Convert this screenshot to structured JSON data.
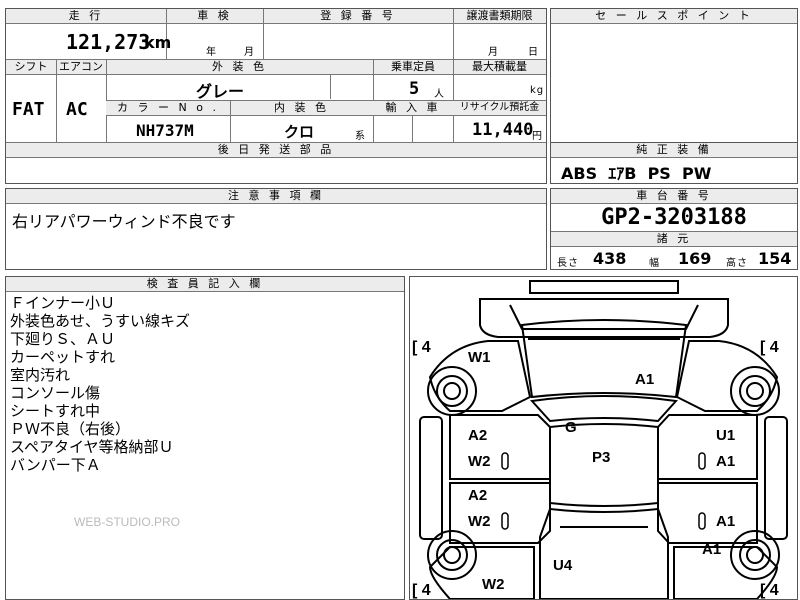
{
  "top_table": {
    "mileage_header": "走 行",
    "mileage_value": "121,273",
    "mileage_unit": "km",
    "inspection_header": "車 検",
    "inspection_year": "年",
    "inspection_month": "月",
    "registration_header": "登 録 番 号",
    "transfer_header": "譲渡書類期限",
    "transfer_month": "月",
    "transfer_day": "日",
    "shift_header": "シフト",
    "aircon_header": "エアコン",
    "color_header": "外 装 色",
    "seats_header": "乗車定員",
    "load_header": "最大積載量",
    "shift_value": "FAT",
    "aircon_value": "AC",
    "color_value": "グレー",
    "seats_value": "5",
    "seats_unit": "人",
    "load_unit": "kg",
    "color_no_header": "カ ラ ー N o .",
    "interior_header": "内 装 色",
    "import_header": "輸 入 車",
    "recycle_header": "リサイクル預託金",
    "color_no_value": "NH737M",
    "interior_value": "クロ",
    "interior_unit": "系",
    "recycle_value": "11,440",
    "recycle_unit": "円",
    "later_parts_header": "後 日 発 送 部 品"
  },
  "sales_point": {
    "header": "セ ー ル ス ポ イ ン ト"
  },
  "equipment": {
    "header": "純 正 装 備",
    "value": "ABS  ｴｱB  PS  PW"
  },
  "caution": {
    "header": "注 意 事 項 欄",
    "text": "右リアパワーウィンド不良です"
  },
  "chassis": {
    "header": "車 台 番 号",
    "value": "GP2-3203188",
    "spec_header": "諸 元",
    "length_label": "長さ",
    "length_value": "438",
    "width_label": "幅",
    "width_value": "169",
    "height_label": "高さ",
    "height_value": "154"
  },
  "inspector": {
    "header": "検 査 員 記 入 欄",
    "notes": [
      "Ｆインナー小Ｕ",
      "外装色あせ、うすい線キズ",
      "下廻りＳ、ＡＵ",
      "カーペットすれ",
      "室内汚れ",
      "コンソール傷",
      "シートすれ中",
      "ＰＷ不良（右後）",
      "スペアタイヤ等格納部Ｕ",
      "バンパー下Ａ"
    ],
    "watermark": "WEB-STUDIO.PRO"
  },
  "diagram": {
    "tire_fl": "4",
    "tire_fr": "4",
    "tire_rl": "4",
    "tire_rr": "4",
    "marks": {
      "w1": "W1",
      "a1_hood": "A1",
      "g": "G",
      "a2_fl": "A2",
      "w2_fl": "W2",
      "u1": "U1",
      "a1_fr": "A1",
      "p3": "P3",
      "a2_rl": "A2",
      "w2_rl": "W2",
      "a1_rr": "A1",
      "a1_rq": "A1",
      "u4": "U4",
      "w2_rear": "W2"
    }
  }
}
